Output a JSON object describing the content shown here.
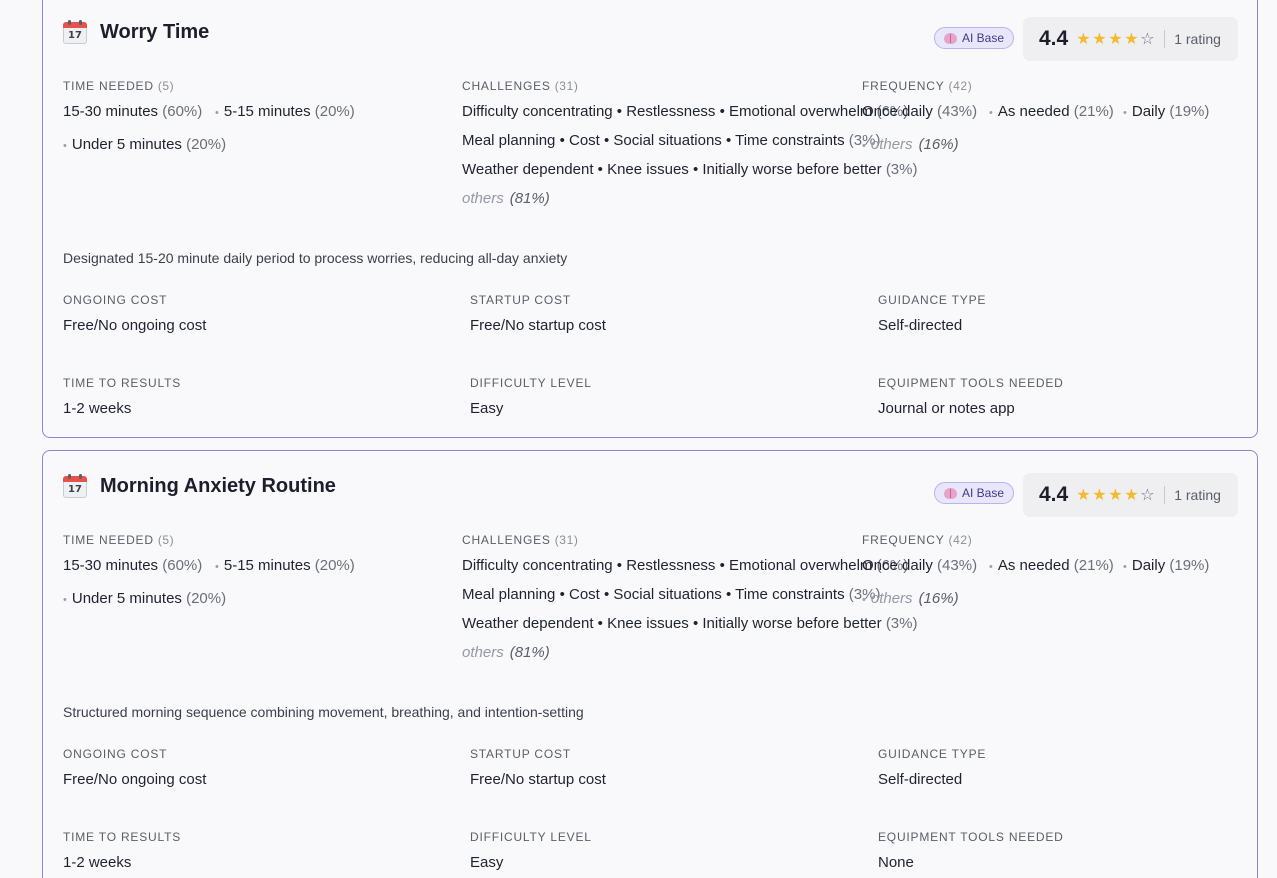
{
  "cards": [
    {
      "title": "Worry Time",
      "badge": "AI Base",
      "rating": "4.4",
      "rating_count": "1 rating",
      "time_needed": {
        "label": "Time Needed",
        "count": "(5)",
        "items": [
          {
            "text": "15-30 minutes",
            "pct": "(60%)"
          },
          {
            "text": "5-15 minutes",
            "pct": "(20%)"
          },
          {
            "text": "Under 5 minutes",
            "pct": "(20%)"
          }
        ]
      },
      "challenges": {
        "label": "Challenges",
        "count": "(31)",
        "rows": [
          {
            "text": "Difficulty concentrating • Restlessness • Emotional overwhelm",
            "pct": "(6%)"
          },
          {
            "text": "Meal planning • Cost • Social situations • Time constraints",
            "pct": "(3%)"
          },
          {
            "text": "Weather dependent • Knee issues • Initially worse before better",
            "pct": "(3%)"
          }
        ],
        "others": "others",
        "others_pct": "(81%)"
      },
      "frequency": {
        "label": "Frequency",
        "count": "(42)",
        "items": [
          {
            "text": "Once daily",
            "pct": "(43%)"
          },
          {
            "text": "As needed",
            "pct": "(21%)"
          },
          {
            "text": "Daily",
            "pct": "(19%)"
          }
        ],
        "others": "others",
        "others_pct": "(16%)"
      },
      "description": "Designated 15-20 minute daily period to process worries, reducing all-day anxiety",
      "details": [
        {
          "label": "Ongoing Cost",
          "value": "Free/No ongoing cost"
        },
        {
          "label": "Startup Cost",
          "value": "Free/No startup cost"
        },
        {
          "label": "Guidance Type",
          "value": "Self-directed"
        },
        {
          "label": "Time To Results",
          "value": "1-2 weeks"
        },
        {
          "label": "Difficulty Level",
          "value": "Easy"
        },
        {
          "label": "Equipment Tools Needed",
          "value": "Journal or notes app"
        }
      ]
    },
    {
      "title": "Morning Anxiety Routine",
      "badge": "AI Base",
      "rating": "4.4",
      "rating_count": "1 rating",
      "time_needed": {
        "label": "Time Needed",
        "count": "(5)",
        "items": [
          {
            "text": "15-30 minutes",
            "pct": "(60%)"
          },
          {
            "text": "5-15 minutes",
            "pct": "(20%)"
          },
          {
            "text": "Under 5 minutes",
            "pct": "(20%)"
          }
        ]
      },
      "challenges": {
        "label": "Challenges",
        "count": "(31)",
        "rows": [
          {
            "text": "Difficulty concentrating • Restlessness • Emotional overwhelm",
            "pct": "(6%)"
          },
          {
            "text": "Meal planning • Cost • Social situations • Time constraints",
            "pct": "(3%)"
          },
          {
            "text": "Weather dependent • Knee issues • Initially worse before better",
            "pct": "(3%)"
          }
        ],
        "others": "others",
        "others_pct": "(81%)"
      },
      "frequency": {
        "label": "Frequency",
        "count": "(42)",
        "items": [
          {
            "text": "Once daily",
            "pct": "(43%)"
          },
          {
            "text": "As needed",
            "pct": "(21%)"
          },
          {
            "text": "Daily",
            "pct": "(19%)"
          }
        ],
        "others": "others",
        "others_pct": "(16%)"
      },
      "description": "Structured morning sequence combining movement, breathing, and intention-setting",
      "details": [
        {
          "label": "Ongoing Cost",
          "value": "Free/No ongoing cost"
        },
        {
          "label": "Startup Cost",
          "value": "Free/No startup cost"
        },
        {
          "label": "Guidance Type",
          "value": "Self-directed"
        },
        {
          "label": "Time To Results",
          "value": "1-2 weeks"
        },
        {
          "label": "Difficulty Level",
          "value": "Easy"
        },
        {
          "label": "Equipment Tools Needed",
          "value": "None"
        }
      ]
    }
  ],
  "icons": {
    "title_icon": "calendar-icon",
    "badge_icon": "brain-icon",
    "star": "star-icon"
  },
  "colors": {
    "card_border": "#8b85d6",
    "star": "#f5b82e",
    "badge_bg": "#e8e6fb"
  }
}
